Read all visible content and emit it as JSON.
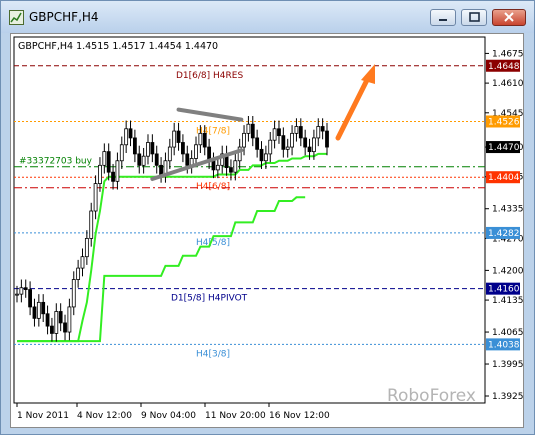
{
  "window": {
    "title": "GBPCHF,H4"
  },
  "chart_data": {
    "type": "candlestick",
    "symbol": "GBPCHF,H4",
    "ohlc_header": "GBPCHF,H4  1.4515 1.4517 1.4454 1.4470",
    "y_ticks": [
      "1.4675",
      "1.4610",
      "1.4545",
      "1.4470",
      "1.4405",
      "1.4335",
      "1.4270",
      "1.4200",
      "1.4135",
      "1.4065",
      "1.3995",
      "1.3925"
    ],
    "x_ticks": [
      "1 Nov 2011",
      "4 Nov 12:00",
      "9 Nov 04:00",
      "11 Nov 20:00",
      "16 Nov 12:00"
    ],
    "ylim": [
      1.3925,
      1.47
    ],
    "levels": [
      {
        "label": "D1[6/8] H4RES",
        "price_tag": "1.4648",
        "value": 1.4648,
        "color": "#8b0000",
        "style": "dashed"
      },
      {
        "label": "H4[7/8]",
        "price_tag": "1.4526",
        "value": 1.4526,
        "color": "#ff9b00",
        "style": "dotted"
      },
      {
        "label": "",
        "price_tag": "1.4470",
        "value": 1.447,
        "color": "#000000",
        "style": "current"
      },
      {
        "label": "#33372703 buy",
        "price_tag": "",
        "value": 1.4427,
        "color": "#008000",
        "style": "dashdot"
      },
      {
        "label": "H4[6/8]",
        "price_tag": "1.4404",
        "value": 1.4404,
        "color": "#ff3300",
        "style": "dotted"
      },
      {
        "label": "",
        "price_tag": "",
        "value": 1.4381,
        "color": "#cc0000",
        "style": "dashdot"
      },
      {
        "label": "H4[5/8]",
        "price_tag": "1.4282",
        "value": 1.4282,
        "color": "#3a8fd6",
        "style": "dotted"
      },
      {
        "label": "D1[5/8] H4PIVOT",
        "price_tag": "1.4160",
        "value": 1.416,
        "color": "#00008b",
        "style": "dashed"
      },
      {
        "label": "H4[3/8]",
        "price_tag": "1.4038",
        "value": 1.4038,
        "color": "#3a8fd6",
        "style": "dotted"
      }
    ],
    "close_series": [
      1.4148,
      1.4162,
      1.4158,
      1.412,
      1.4095,
      1.413,
      1.4105,
      1.4078,
      1.4062,
      1.411,
      1.4085,
      1.4065,
      1.412,
      1.418,
      1.4205,
      1.423,
      1.427,
      1.433,
      1.439,
      1.443,
      1.446,
      1.4415,
      1.4395,
      1.444,
      1.4475,
      1.451,
      1.449,
      1.4455,
      1.443,
      1.445,
      1.448,
      1.4455,
      1.443,
      1.441,
      1.444,
      1.447,
      1.4505,
      1.448,
      1.4455,
      1.443,
      1.4445,
      1.4475,
      1.45,
      1.447,
      1.444,
      1.442,
      1.443,
      1.4455,
      1.4425,
      1.4415,
      1.444,
      1.447,
      1.45,
      1.452,
      1.449,
      1.4465,
      1.444,
      1.4455,
      1.4485,
      1.451,
      1.4495,
      1.4465,
      1.447,
      1.45,
      1.4515,
      1.449,
      1.447,
      1.446,
      1.449,
      1.4515,
      1.4505,
      1.447
    ],
    "trailing_stop": [
      1.4045,
      1.4045,
      1.4045,
      1.4045,
      1.4045,
      1.4045,
      1.4045,
      1.4045,
      1.4045,
      1.4045,
      1.4045,
      1.4045,
      1.4045,
      1.4045,
      1.4045,
      1.409,
      1.413,
      1.42,
      1.428,
      1.433,
      1.4395,
      1.4405,
      1.4405,
      1.4405,
      1.4405,
      1.4405,
      1.4405,
      1.4405,
      1.4405,
      1.4405,
      1.4405,
      1.4405,
      1.4405,
      1.4405,
      1.4405,
      1.4405,
      1.4405,
      1.4405,
      1.4405,
      1.4405,
      1.4405,
      1.4405,
      1.4405,
      1.4405,
      1.4405,
      1.4405,
      1.441,
      1.441,
      1.441,
      1.441,
      1.441,
      1.442,
      1.442,
      1.442,
      1.443,
      1.443,
      1.443,
      1.4435,
      1.4435,
      1.4435,
      1.444,
      1.444,
      1.444,
      1.4445,
      1.4445,
      1.4445,
      1.445,
      1.445,
      1.445,
      1.4455,
      1.4455,
      1.4455
    ],
    "lower_trailing": [
      1.4045,
      1.4045,
      1.4045,
      1.4045,
      1.4045,
      1.4045,
      1.4045,
      1.4045,
      1.4045,
      1.4045,
      1.4045,
      1.4045,
      1.4045,
      1.4045,
      1.4045,
      1.4045,
      1.4045,
      1.4045,
      1.4045,
      1.4045,
      1.4188,
      1.4188,
      1.4188,
      1.4188,
      1.4188,
      1.4188,
      1.4188,
      1.4188,
      1.4188,
      1.4188,
      1.4188,
      1.4188,
      1.4188,
      1.4188,
      1.421,
      1.421,
      1.421,
      1.421,
      1.4232,
      1.4232,
      1.4232,
      1.4232,
      1.4252,
      1.4252,
      1.4252,
      1.4275,
      1.4275,
      1.4275,
      1.4275,
      1.4275,
      1.4305,
      1.4305,
      1.4305,
      1.4305,
      1.4305,
      1.433,
      1.433,
      1.433,
      1.433,
      1.433,
      1.4352,
      1.4352,
      1.4352,
      1.4352,
      1.436,
      1.436,
      1.436
    ],
    "triangle": {
      "upper": [
        [
          1.4552,
          37
        ],
        [
          1.453,
          50
        ]
      ],
      "lower": [
        [
          1.44,
          31
        ],
        [
          1.4463,
          50
        ]
      ]
    },
    "forecast_arrow": "up",
    "watermark": "RoboForex"
  },
  "colors": {
    "candle": "#000000",
    "trailing": "#33ee22",
    "triangle": "#808080",
    "arrow": "#ff7a1f",
    "tag_bg_res": "#ffffff",
    "watermark": "#b0b0b0"
  }
}
